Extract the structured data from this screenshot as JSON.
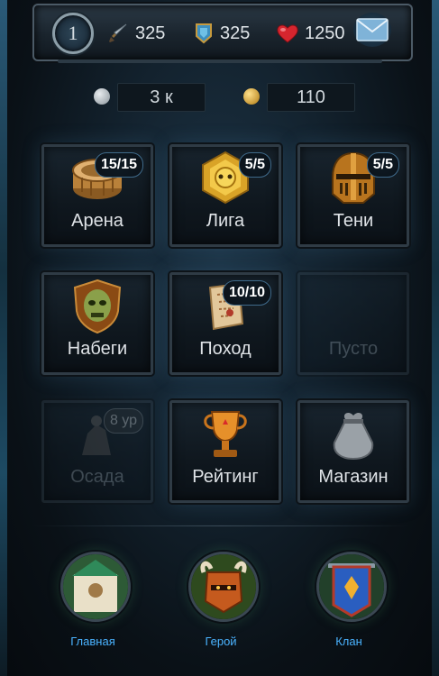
{
  "header": {
    "level": "1",
    "attack": "325",
    "armor": "325",
    "health": "1250",
    "icons": {
      "attack": "sword-icon",
      "armor": "armor-icon",
      "health": "heart-icon",
      "mail": "mail-icon"
    }
  },
  "currency": {
    "silver": "3 к",
    "gold": "110"
  },
  "tiles": [
    {
      "label": "Арена",
      "badge": "15/15",
      "icon": "arena-icon"
    },
    {
      "label": "Лига",
      "badge": "5/5",
      "icon": "league-icon"
    },
    {
      "label": "Тени",
      "badge": "5/5",
      "icon": "helmet-icon"
    },
    {
      "label": "Набеги",
      "badge": "",
      "icon": "raid-shield-icon"
    },
    {
      "label": "Поход",
      "badge": "10/10",
      "icon": "scroll-map-icon"
    },
    {
      "label": "Пусто",
      "badge": "",
      "icon": ""
    },
    {
      "label": "Осада",
      "badge": "8 ур",
      "icon": "siege-icon"
    },
    {
      "label": "Рейтинг",
      "badge": "",
      "icon": "trophy-icon"
    },
    {
      "label": "Магазин",
      "badge": "",
      "icon": "bag-icon"
    }
  ],
  "nav": [
    {
      "label": "Главная",
      "icon": "home-icon"
    },
    {
      "label": "Герой",
      "icon": "hero-icon"
    },
    {
      "label": "Клан",
      "icon": "clan-banner-icon"
    }
  ],
  "colors": {
    "nav_label": "#4ab3ff",
    "background": "#0b1218"
  }
}
